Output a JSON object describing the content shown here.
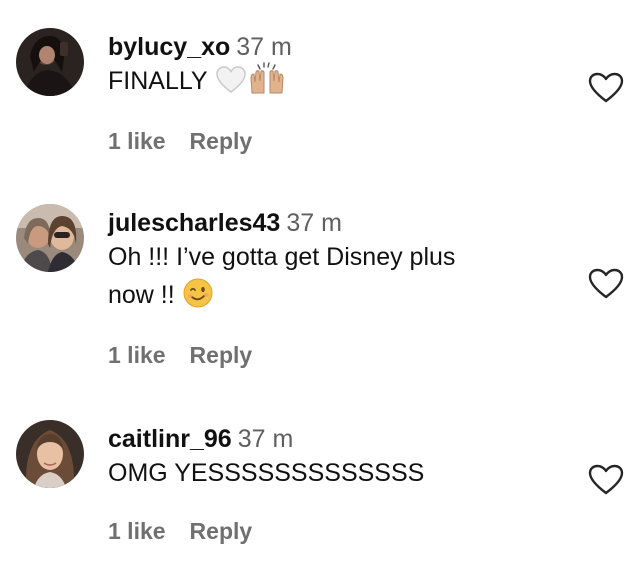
{
  "comments": [
    {
      "username": "bylucy_xo",
      "time": "37 m",
      "text": "FINALLY",
      "emojis": [
        "white-heart-icon",
        "raising-hands-icon"
      ],
      "likes": "1 like",
      "reply": "Reply"
    },
    {
      "username": "julescharles43",
      "time": "37 m",
      "text_line1": "Oh !!! I’ve gotta get Disney plus",
      "text_line2": "now !!",
      "emojis": [
        "winking-face-icon"
      ],
      "likes": "1 like",
      "reply": "Reply"
    },
    {
      "username": "caitlinr_96",
      "time": "37 m",
      "text": "OMG YESSSSSSSSSSSSS",
      "likes": "1 like",
      "reply": "Reply"
    }
  ],
  "icons": {
    "like": "heart-outline-icon"
  },
  "colors": {
    "text": "#111111",
    "secondary": "#707070",
    "heart_stroke": "#262626"
  }
}
